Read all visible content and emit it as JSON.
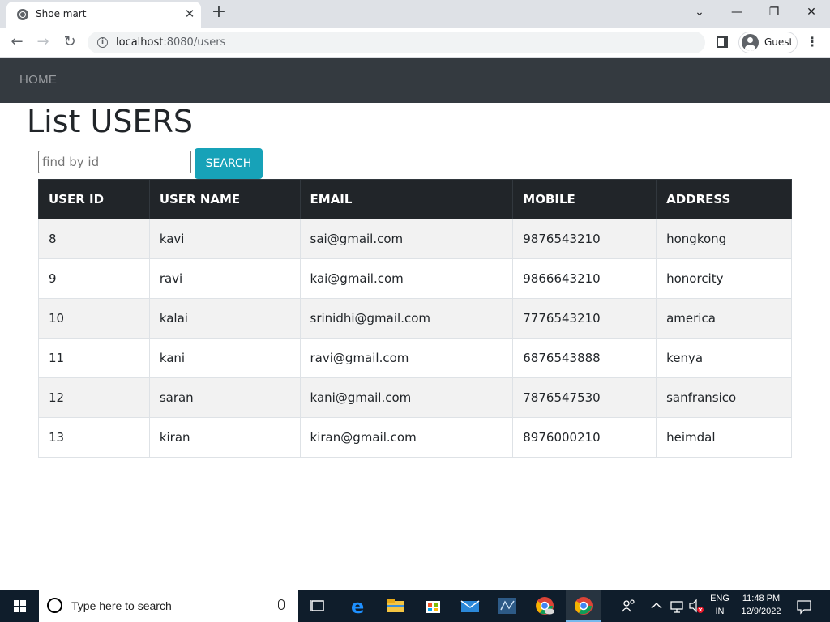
{
  "browser": {
    "tab_title": "Shoe mart",
    "url_host": "localhost",
    "url_path": ":8080/users",
    "profile_label": "Guest"
  },
  "navbar": {
    "home_label": "HOME"
  },
  "page": {
    "heading": "List USERS",
    "search_placeholder": "find by id",
    "search_button": "SEARCH"
  },
  "table": {
    "columns": [
      "USER ID",
      "USER NAME",
      "EMAIL",
      "MOBILE",
      "ADDRESS"
    ],
    "rows": [
      [
        "8",
        "kavi",
        "sai@gmail.com",
        "9876543210",
        "hongkong"
      ],
      [
        "9",
        "ravi",
        "kai@gmail.com",
        "9866643210",
        "honorcity"
      ],
      [
        "10",
        "kalai",
        "srinidhi@gmail.com",
        "7776543210",
        "america"
      ],
      [
        "11",
        "kani",
        "ravi@gmail.com",
        "6876543888",
        "kenya"
      ],
      [
        "12",
        "saran",
        "kani@gmail.com",
        "7876547530",
        "sanfransico"
      ],
      [
        "13",
        "kiran",
        "kiran@gmail.com",
        "8976000210",
        "heimdal"
      ]
    ]
  },
  "taskbar": {
    "search_placeholder": "Type here to search",
    "lang_top": "ENG",
    "lang_bottom": "IN",
    "time": "11:48 PM",
    "date": "12/9/2022"
  },
  "colors": {
    "navbar_bg": "#343a40",
    "table_header_bg": "#212529",
    "search_button_bg": "#17a2b8",
    "taskbar_bg": "#0f1d2b"
  }
}
